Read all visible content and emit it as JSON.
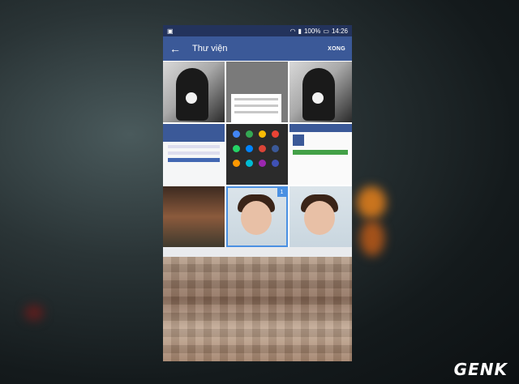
{
  "status": {
    "battery": "100%",
    "time": "14:26"
  },
  "appbar": {
    "title": "Thư viện",
    "done_label": "XONG"
  },
  "gallery": {
    "selected_index": 7,
    "badge": "1",
    "items": [
      {
        "kind": "photo-man"
      },
      {
        "kind": "screenshot-dialog"
      },
      {
        "kind": "photo-man"
      },
      {
        "kind": "screenshot-login"
      },
      {
        "kind": "screenshot-share"
      },
      {
        "kind": "screenshot-store"
      },
      {
        "kind": "photo-market"
      },
      {
        "kind": "photo-child"
      },
      {
        "kind": "photo-child"
      }
    ]
  },
  "watermark": "GENK"
}
